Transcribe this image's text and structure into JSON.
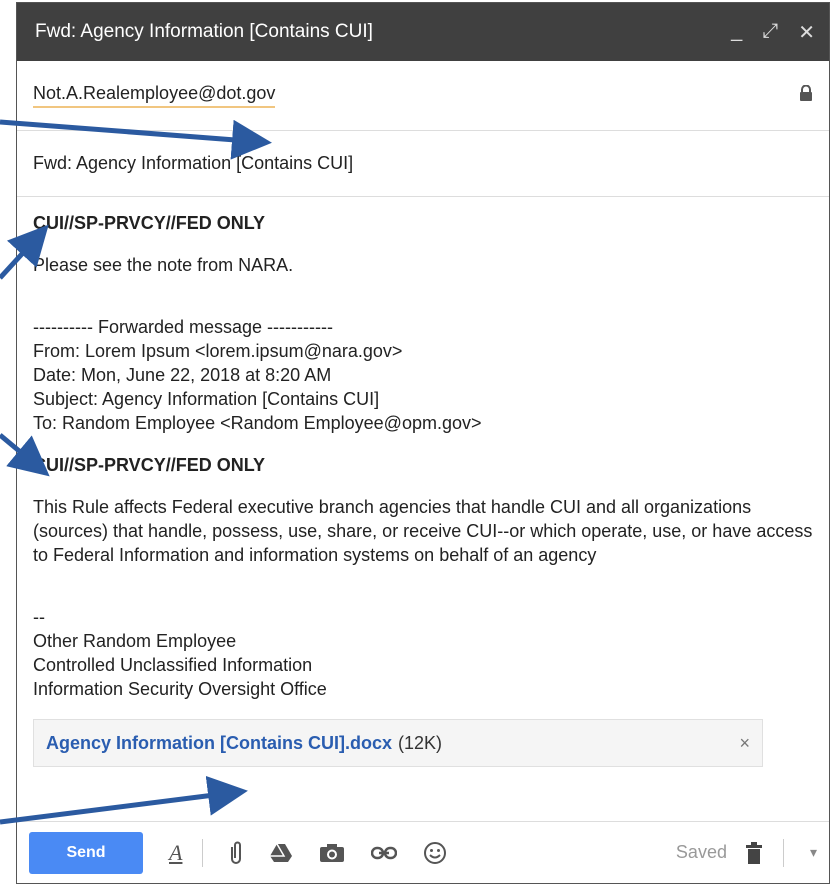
{
  "window": {
    "title": "Fwd: Agency Information [Contains CUI]",
    "controls": {
      "minimize": "_",
      "expand": "⤢",
      "close": "✕"
    }
  },
  "to": {
    "recipient": "Not.A.Realemployee@dot.gov"
  },
  "subject": {
    "value": "Fwd: Agency Information [Contains CUI]"
  },
  "body": {
    "banner_top": "CUI//SP-PRVCY//FED ONLY",
    "note": "Please see the note from NARA.",
    "forward_header": "---------- Forwarded message -----------",
    "from_line": "From: Lorem Ipsum <lorem.ipsum@nara.gov>",
    "date_line": "Date: Mon, June 22, 2018 at 8:20 AM",
    "subject_line": "Subject: Agency Information [Contains CUI]",
    "to_line": "To: Random Employee <Random Employee@opm.gov>",
    "banner_inner": "CUI//SP-PRVCY//FED ONLY",
    "rule_text": "This Rule affects Federal executive branch agencies that handle CUI and all organizations (sources) that handle, possess, use, share, or receive CUI--or which operate, use, or have access to Federal Information and information systems on behalf of an agency",
    "sig_dash": "--",
    "sig_name": "Other Random Employee",
    "sig_line2": "Controlled Unclassified Information",
    "sig_line3": "Information Security Oversight Office"
  },
  "attachment": {
    "name": "Agency Information [Contains CUI].docx",
    "size": "(12K)",
    "remove": "×"
  },
  "toolbar": {
    "send_label": "Send",
    "format_label": "A",
    "saved_label": "Saved"
  },
  "colors": {
    "titlebar": "#404040",
    "send_button": "#4a8af4",
    "attachment_link": "#2a5db0",
    "arrow": "#2b5aa0"
  },
  "icons": [
    "lock-icon",
    "formatting-icon",
    "attach-icon",
    "drive-icon",
    "photo-icon",
    "link-icon",
    "emoji-icon",
    "trash-icon",
    "more-options-icon"
  ]
}
